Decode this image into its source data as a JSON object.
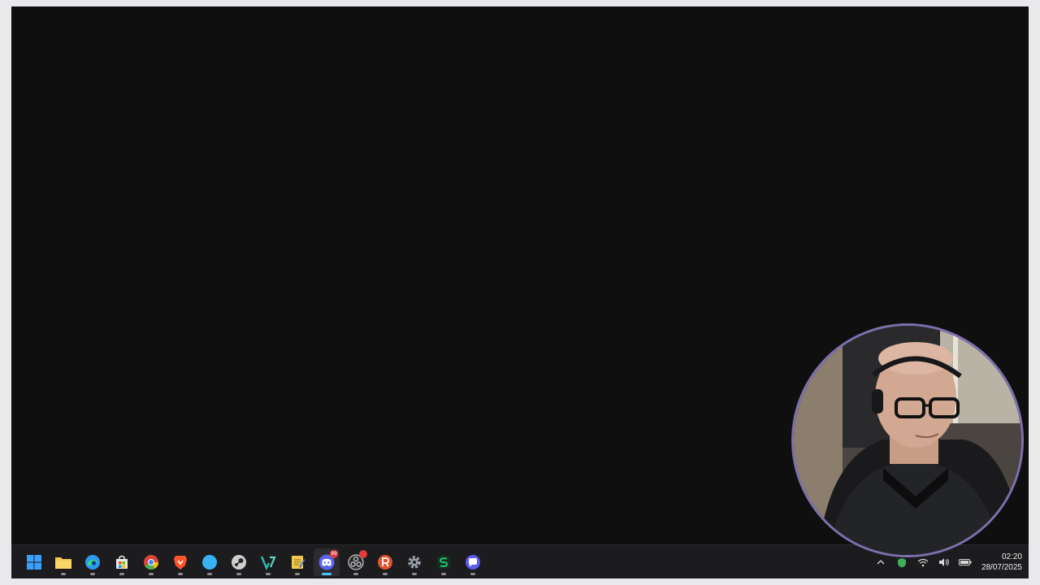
{
  "taskbar": {
    "apps": [
      {
        "name": "start-button",
        "icon": "windows-logo-icon",
        "color": "#3aa0ff",
        "active": false
      },
      {
        "name": "file-explorer-button",
        "icon": "folder-icon",
        "color": "#f5c84c",
        "active": false
      },
      {
        "name": "edge-button",
        "icon": "edge-icon",
        "color": "#2b9af3",
        "active": false
      },
      {
        "name": "store-button",
        "icon": "store-icon",
        "color": "#e8e8e8",
        "active": false
      },
      {
        "name": "chrome-button",
        "icon": "chrome-icon",
        "color": "#4caf50",
        "active": false
      },
      {
        "name": "brave-button",
        "icon": "brave-lion-icon",
        "color": "#fb542b",
        "active": false
      },
      {
        "name": "browser-compass-button",
        "icon": "compass-icon",
        "color": "#3ab0f5",
        "active": false
      },
      {
        "name": "steam-button",
        "icon": "steam-icon",
        "color": "#cfcfcf",
        "active": false
      },
      {
        "name": "app-v-button",
        "icon": "v-logo-icon",
        "color": "#2fb6a8",
        "active": false
      },
      {
        "name": "notepad-button",
        "icon": "notepad-icon",
        "color": "#f2c94c",
        "active": false
      },
      {
        "name": "discord-button",
        "icon": "discord-icon",
        "color": "#5865f2",
        "active": true,
        "badge": "99"
      },
      {
        "name": "obs-button",
        "icon": "obs-icon",
        "color": "#d0d0d0",
        "active": false,
        "badge": ""
      },
      {
        "name": "app-r-button",
        "icon": "r-logo-icon",
        "color": "#e2512c",
        "active": false
      },
      {
        "name": "settings-button",
        "icon": "gear-icon",
        "color": "#9aa0a8",
        "active": false
      },
      {
        "name": "app-s-button",
        "icon": "s-logo-icon",
        "color": "#23c36b",
        "active": false
      },
      {
        "name": "app-chat-button",
        "icon": "chat-bubble-icon",
        "color": "#5b5cf0",
        "active": false
      }
    ]
  },
  "tray": {
    "icons": [
      "chevron-up-icon",
      "shield-icon",
      "wifi-icon",
      "speaker-icon",
      "battery-icon"
    ],
    "time": "02:20",
    "date": "28/07/2025"
  }
}
